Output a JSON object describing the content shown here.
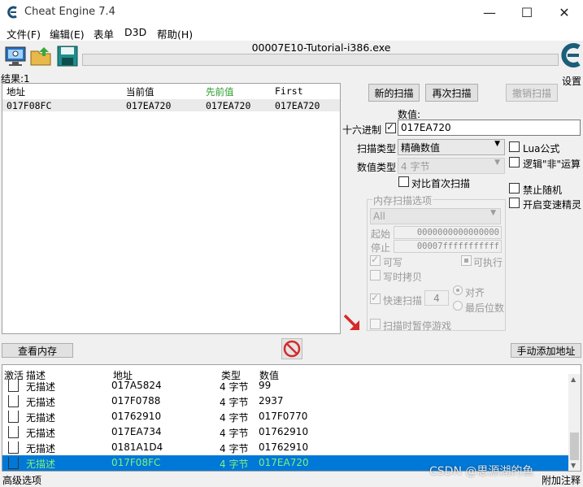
{
  "window": {
    "title": "Cheat Engine 7.4",
    "minimize": "—",
    "maximize": "☐",
    "close": "✕"
  },
  "menu": [
    "文件(F)",
    "编辑(E)",
    "表单",
    "D3D",
    "帮助(H)"
  ],
  "process_name": "00007E10-Tutorial-i386.exe",
  "settings_label": "设置",
  "results_count": "结果:1",
  "results": {
    "headers": [
      "地址",
      "当前值",
      "先前值",
      "First"
    ],
    "rows": [
      [
        "017F08FC",
        "017EA720",
        "017EA720",
        "017EA720"
      ]
    ]
  },
  "scan": {
    "new_scan": "新的扫描",
    "next_scan": "再次扫描",
    "undo_scan": "撤销扫描",
    "value_label": "数值:",
    "hex_label": "十六进制",
    "value": "017EA720",
    "scan_type_label": "扫描类型",
    "scan_type": "精确数值",
    "value_type_label": "数值类型",
    "value_type": "4 字节",
    "compare_first": "对比首次扫描",
    "lua": "Lua公式",
    "not_logic": "逻辑\"非\"运算",
    "no_random": "禁止随机",
    "speedhack": "开启变速精灵"
  },
  "memory_options": {
    "title": "内存扫描选项",
    "region": "All",
    "start_label": "起始",
    "start": "0000000000000000",
    "stop_label": "停止",
    "stop": "00007fffffffffff",
    "writable": "可写",
    "executable": "可执行",
    "copy_on_write": "写时拷贝",
    "fast_scan": "快速扫描",
    "fast_scan_value": "4",
    "align": "对齐",
    "last_digits": "最后位数",
    "pause_game": "扫描时暂停游戏"
  },
  "view_memory": "查看内存",
  "add_address": "手动添加地址",
  "address_list": {
    "headers": [
      "激活",
      "描述",
      "地址",
      "类型",
      "数值"
    ],
    "rows": [
      [
        "无描述",
        "017A5824",
        "4 字节",
        "99"
      ],
      [
        "无描述",
        "017F0788",
        "4 字节",
        "2937"
      ],
      [
        "无描述",
        "01762910",
        "4 字节",
        "017F0770"
      ],
      [
        "无描述",
        "017EA734",
        "4 字节",
        "01762910"
      ],
      [
        "无描述",
        "0181A1D4",
        "4 字节",
        "01762910"
      ],
      [
        "无描述",
        "017F08FC",
        "4 字节",
        "017EA720"
      ]
    ]
  },
  "status": {
    "advanced": "高级选项",
    "comments": "附加注释"
  },
  "watermark": "CSDN @思源湖的鱼",
  "colors": {
    "selection": "#0078d7",
    "selected_text": "#7ef27e",
    "previous_value_header": "#2a9d2a"
  }
}
